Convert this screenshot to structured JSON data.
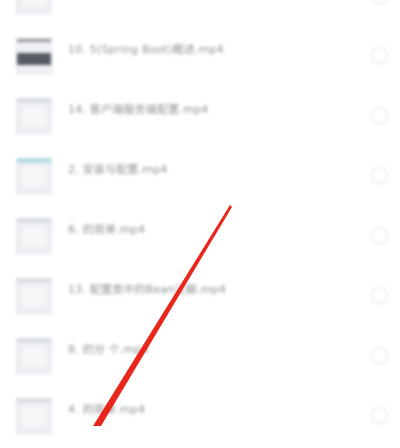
{
  "files": [
    {
      "title": "",
      "meta": [
        "",
        "",
        ""
      ],
      "thumb_style": "plain"
    },
    {
      "title": "10. 5(Spring Boot)概述.mp4",
      "meta": [
        "",
        "",
        ""
      ],
      "thumb_style": "dark"
    },
    {
      "title": "14. 客户端服务端配置.mp4",
      "meta": [
        "",
        "",
        ""
      ],
      "thumb_style": "plain"
    },
    {
      "title": "2. 安装与配置.mp4",
      "meta": [
        "",
        "",
        ""
      ],
      "thumb_style": "teal"
    },
    {
      "title": "6. 的简单.mp4",
      "meta": [
        "",
        "",
        ""
      ],
      "thumb_style": "plain"
    },
    {
      "title": "13. 配置类中的Bean注解.mp4",
      "meta": [
        "",
        "",
        ""
      ],
      "thumb_style": "plain"
    },
    {
      "title": "8. 的分 个.mp4",
      "meta": [
        "",
        "",
        ""
      ],
      "thumb_style": "plain"
    },
    {
      "title": "4. 的简单.mp4",
      "meta": [
        "",
        "",
        ""
      ],
      "thumb_style": "plain"
    }
  ],
  "icons": {
    "row_thumbnail": "video-file-thumbnail-icon",
    "row_select": "radio-unchecked-icon"
  },
  "colors": {
    "annotation_arrow": "#e8261c",
    "radio_border": "#e1e3e6",
    "title_text": "#8a8e95",
    "meta_text": "#c0c3c8"
  }
}
